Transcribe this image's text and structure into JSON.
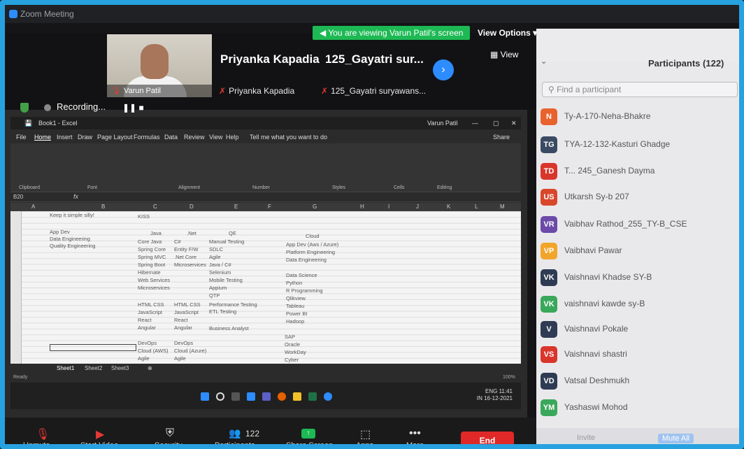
{
  "window": {
    "title": "Zoom Meeting"
  },
  "banner": {
    "viewing": "You are viewing Varun Patil's screen",
    "view_options": "View Options"
  },
  "videos": {
    "self_name": "Varun Patil",
    "tile1_big": "Priyanka Kapadia",
    "tile1_small": "Priyanka Kapadia",
    "tile2_big": "125_Gayatri sur...",
    "tile2_small": "125_Gayatri suryawans...",
    "view_label": "View"
  },
  "recording": {
    "label": "Recording..."
  },
  "excel": {
    "title": "Book1 - Excel",
    "user": "Varun Patil",
    "share": "Share",
    "tabs": [
      "File",
      "Home",
      "Insert",
      "Draw",
      "Page Layout",
      "Formulas",
      "Data",
      "Review",
      "View",
      "Help"
    ],
    "tell_me": "Tell me what you want to do",
    "cell_ref": "B20",
    "groups": [
      "Clipboard",
      "Font",
      "Alignment",
      "Number",
      "Styles",
      "Cells",
      "Editing"
    ],
    "columns": [
      "A",
      "B",
      "C",
      "D",
      "E",
      "F",
      "G",
      "H",
      "I",
      "J",
      "K",
      "L",
      "M"
    ],
    "cells": {
      "b1": "Keep it simple silly!",
      "c1": "KISS",
      "b3": "App Dev",
      "b4": "Data Engineering",
      "b5": "Quality Engineering",
      "h_java": "Java",
      "h_net": ".Net",
      "h_qe": "QE",
      "h_cloud": "Cloud",
      "java": [
        "Core Java",
        "Spring Core",
        "Spring MVC",
        "Spring Boot",
        "Hibernate",
        "Web Services",
        "Microservices"
      ],
      "net": [
        "C#",
        "Entity F/W",
        ".Net Core",
        "Microservices"
      ],
      "qe": [
        "Manual Testing",
        "SDLC",
        "Agile",
        "Java / C#",
        "Selenium",
        "Mobile Testing",
        "Appium",
        "QTP",
        "Performance Testing",
        "ETL Testing"
      ],
      "cloud": [
        "App Dev (Aws / Azure)",
        "Platform Engineering",
        "Data Engineering"
      ],
      "ds": [
        "Data Science",
        "Python",
        "R Programming",
        "Qlikview",
        "Tableau",
        "Power BI",
        "Hadoop"
      ],
      "web1": [
        "HTML CSS",
        "JavaScript",
        "React",
        "Angular"
      ],
      "web2": [
        "HTML CSS",
        "JavaScript",
        "React",
        "Angular"
      ],
      "ba": "Business Analyst",
      "devops1": [
        "DevOps",
        "Cloud (AWS)",
        "Agile"
      ],
      "devops2": [
        "DevOps",
        "Cloud (Azure)",
        "Agile"
      ],
      "sap": [
        "SAP",
        "Oracle",
        "WorkDay",
        "Cyber"
      ]
    },
    "sheets": [
      "Sheet1",
      "Sheet2",
      "Sheet3"
    ],
    "status": "Ready",
    "zoom": "100%"
  },
  "taskbar": {
    "lang1": "ENG",
    "lang2": "IN",
    "time": "11:41",
    "date": "16-12-2021"
  },
  "participants": {
    "title": "Participants (122)",
    "search_placeholder": "Find a participant",
    "items": [
      {
        "initials": "N",
        "name": "Ty-A-170-Neha-Bhakre",
        "color": "#e8622e"
      },
      {
        "initials": "TG",
        "name": "TYA-12-132-Kasturi Ghadge",
        "color": "#3b4a63"
      },
      {
        "initials": "TD",
        "name": "T... 245_Ganesh Dayma",
        "color": "#d9362b"
      },
      {
        "initials": "US",
        "name": "Utkarsh Sy-b 207",
        "color": "#d9472b"
      },
      {
        "initials": "VR",
        "name": "Vaibhav Rathod_255_TY-B_CSE",
        "color": "#6b4aa8"
      },
      {
        "initials": "VP",
        "name": "Vaibhavi Pawar",
        "color": "#f2a52b"
      },
      {
        "initials": "VK",
        "name": "Vaishnavi  Khadse SY-B",
        "color": "#2e3b52"
      },
      {
        "initials": "VK",
        "name": "vaishnavi kawde sy-B",
        "color": "#3aa85a"
      },
      {
        "initials": "V",
        "name": "Vaishnavi Pokale",
        "color": "#2e3b52"
      },
      {
        "initials": "VS",
        "name": "Vaishnavi shastri",
        "color": "#d9362b"
      },
      {
        "initials": "VD",
        "name": "Vatsal Deshmukh",
        "color": "#2e3b52"
      },
      {
        "initials": "YM",
        "name": "Yashaswi Mohod",
        "color": "#3aa85a"
      }
    ],
    "invite": "Invite",
    "mute_all": "Mute All"
  },
  "controls": {
    "unmute": "Unmute",
    "start_video": "Start Video",
    "security": "Security",
    "participants": "Participants",
    "participants_count": "122",
    "share_screen": "Share Screen",
    "apps": "Apps",
    "more": "More",
    "end": "End"
  }
}
